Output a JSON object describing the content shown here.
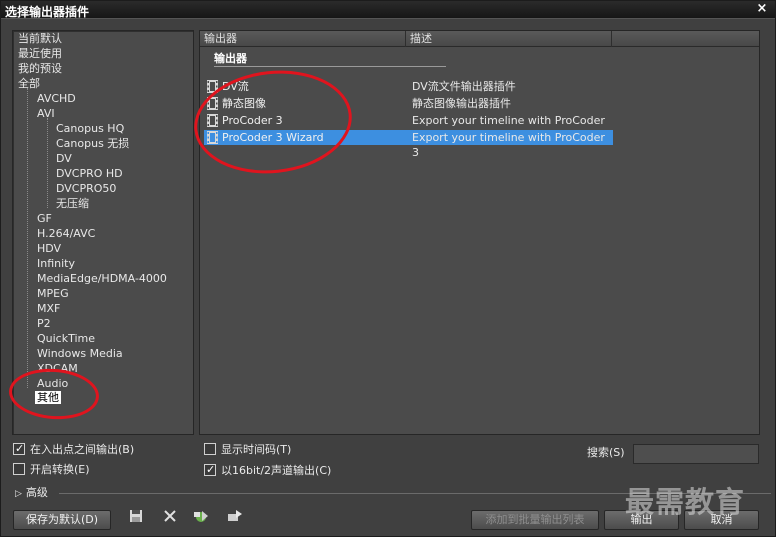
{
  "window": {
    "title": "选择输出器插件",
    "close_symbol": "×"
  },
  "tree": {
    "items": [
      {
        "label": "当前默认",
        "level": 0
      },
      {
        "label": "最近使用",
        "level": 0
      },
      {
        "label": "我的预设",
        "level": 0
      },
      {
        "label": "全部",
        "level": 0
      },
      {
        "label": "AVCHD",
        "level": 1
      },
      {
        "label": "AVI",
        "level": 1
      },
      {
        "label": "Canopus HQ",
        "level": 2
      },
      {
        "label": "Canopus 无损",
        "level": 2
      },
      {
        "label": "DV",
        "level": 2
      },
      {
        "label": "DVCPRO HD",
        "level": 2
      },
      {
        "label": "DVCPRO50",
        "level": 2
      },
      {
        "label": "无压缩",
        "level": 2
      },
      {
        "label": "GF",
        "level": 1
      },
      {
        "label": "H.264/AVC",
        "level": 1
      },
      {
        "label": "HDV",
        "level": 1
      },
      {
        "label": "Infinity",
        "level": 1
      },
      {
        "label": "MediaEdge/HDMA-4000",
        "level": 1
      },
      {
        "label": "MPEG",
        "level": 1
      },
      {
        "label": "MXF",
        "level": 1
      },
      {
        "label": "P2",
        "level": 1
      },
      {
        "label": "QuickTime",
        "level": 1
      },
      {
        "label": "Windows Media",
        "level": 1
      },
      {
        "label": "XDCAM",
        "level": 1
      },
      {
        "label": "Audio",
        "level": 1
      },
      {
        "label": "其他",
        "level": 1,
        "selected": true
      }
    ]
  },
  "list": {
    "columns": [
      "输出器",
      "描述"
    ],
    "group": "输出器",
    "rows": [
      {
        "name": "DV流",
        "description": "DV流文件输出器插件",
        "selected": false
      },
      {
        "name": "静态图像",
        "description": "静态图像输出器插件",
        "selected": false
      },
      {
        "name": "ProCoder 3",
        "description": "Export your timeline with ProCoder 3",
        "selected": false
      },
      {
        "name": "ProCoder 3 Wizard",
        "description": "Export your timeline with ProCoder 3",
        "selected": true
      }
    ]
  },
  "options": {
    "in_out_output": {
      "label": "在入出点之间输出(B)",
      "checked": true
    },
    "enable_convert": {
      "label": "开启转换(E)",
      "checked": false
    },
    "show_timecode": {
      "label": "显示时间码(T)",
      "checked": false
    },
    "output_16bit": {
      "label": "以16bit/2声道输出(C)",
      "checked": true
    }
  },
  "search": {
    "label": "搜索(S)",
    "value": ""
  },
  "advanced": {
    "label": "高级"
  },
  "buttons": {
    "save_default": "保存为默认(D)",
    "add_batch": "添加到批量输出列表",
    "output": "输出",
    "cancel": "取消"
  },
  "toolbar_icons": [
    "save-icon",
    "delete-icon",
    "import-icon",
    "export-icon"
  ],
  "watermark": "最需教育",
  "colors": {
    "selection": "#3d8fe0",
    "annotation": "#e0141e"
  }
}
